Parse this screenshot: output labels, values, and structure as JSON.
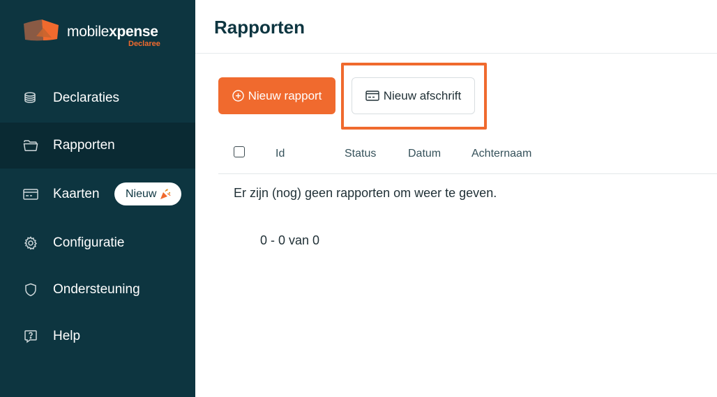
{
  "brand": {
    "name_light": "mobile",
    "name_bold": "xpense",
    "sub": "Declaree",
    "accent": "#f06a2e",
    "sidebar_bg": "#0d3540"
  },
  "sidebar": {
    "items": [
      {
        "label": "Declaraties",
        "icon": "coins-icon",
        "active": false
      },
      {
        "label": "Rapporten",
        "icon": "folder-icon",
        "active": true
      },
      {
        "label": "Kaarten",
        "icon": "credit-card-icon",
        "active": false,
        "badge": "Nieuw",
        "badge_icon": "party-popper-icon"
      },
      {
        "label": "Configuratie",
        "icon": "gear-icon",
        "active": false
      },
      {
        "label": "Ondersteuning",
        "icon": "shield-icon",
        "active": false
      },
      {
        "label": "Help",
        "icon": "question-chat-icon",
        "active": false
      }
    ]
  },
  "header": {
    "title": "Rapporten"
  },
  "toolbar": {
    "new_report_label": "Nieuw rapport",
    "new_statement_label": "Nieuw afschrift"
  },
  "table": {
    "columns": [
      "Id",
      "Status",
      "Datum",
      "Achternaam"
    ],
    "empty_message": "Er zijn (nog) geen rapporten om weer te geven.",
    "pagination": "0 - 0 van 0"
  }
}
